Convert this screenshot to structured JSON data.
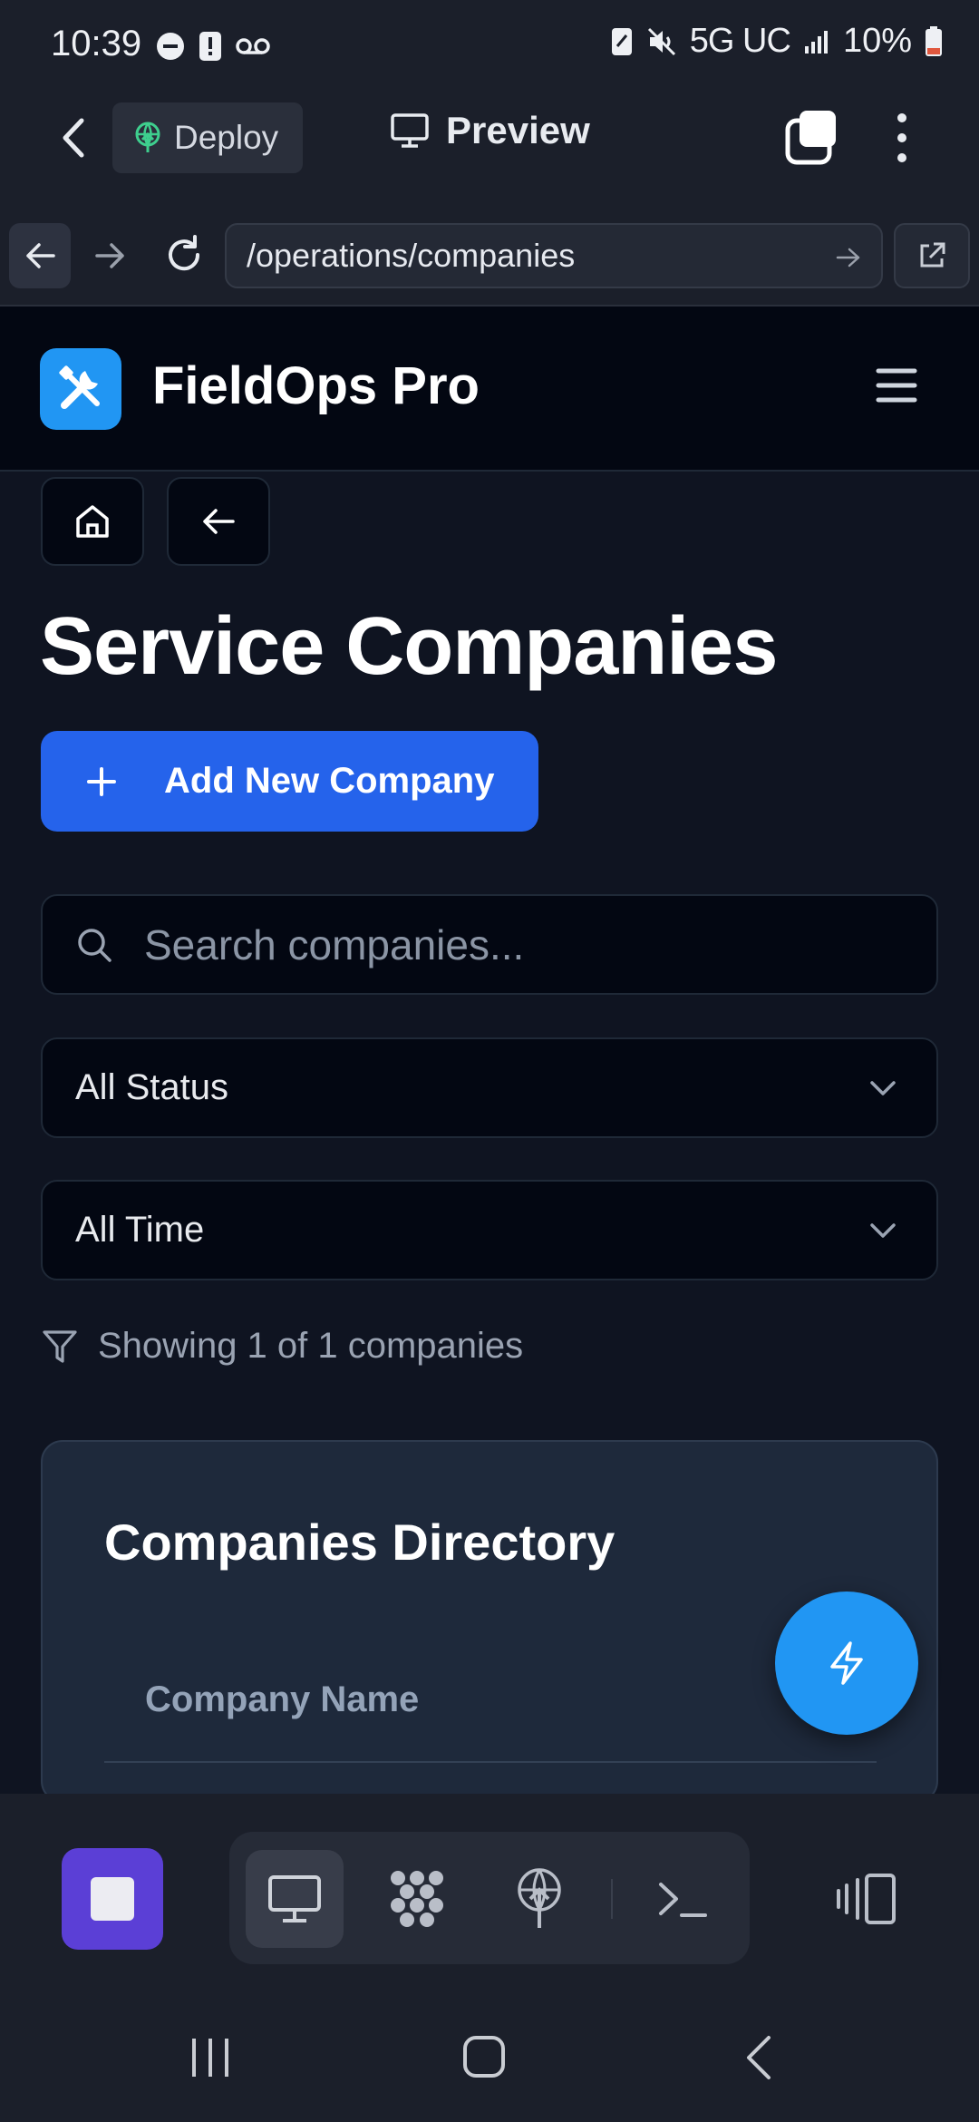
{
  "status_bar": {
    "time": "10:39",
    "network": "5G UC",
    "battery": "10%"
  },
  "app_header": {
    "deploy_label": "Deploy",
    "preview_label": "Preview"
  },
  "url_bar": {
    "url": "/operations/companies"
  },
  "site": {
    "brand": "FieldOps Pro",
    "page_title": "Service Companies",
    "add_button_label": "Add New Company",
    "search_placeholder": "Search companies...",
    "status_filter": "All Status",
    "time_filter": "All Time",
    "showing_text": "Showing 1 of 1 companies",
    "directory_title": "Companies Directory",
    "column_header": "Company Name"
  },
  "colors": {
    "background": "#0f1421",
    "primary_button": "#2563eb",
    "logo_fab": "#2196f3",
    "stop_button": "#5b3fd6",
    "card": "#1e293b"
  },
  "icons": [
    "minus-circle-icon",
    "alert-icon",
    "voicemail-icon",
    "nfc-icon",
    "mute-icon",
    "signal-icon",
    "battery-icon",
    "back-chevron-icon",
    "deploy-icon",
    "monitor-icon",
    "tabs-icon",
    "more-vert-icon",
    "arrow-left-icon",
    "arrow-right-icon",
    "refresh-icon",
    "go-arrow-icon",
    "external-link-icon",
    "wrench-screwdriver-icon",
    "hamburger-icon",
    "home-icon",
    "search-icon",
    "chevron-down-icon",
    "filter-icon",
    "lightning-icon",
    "stop-icon",
    "workspace-icon",
    "deploy-tool-icon",
    "terminal-icon",
    "split-view-icon",
    "recents-icon",
    "home-nav-icon",
    "back-nav-icon"
  ]
}
